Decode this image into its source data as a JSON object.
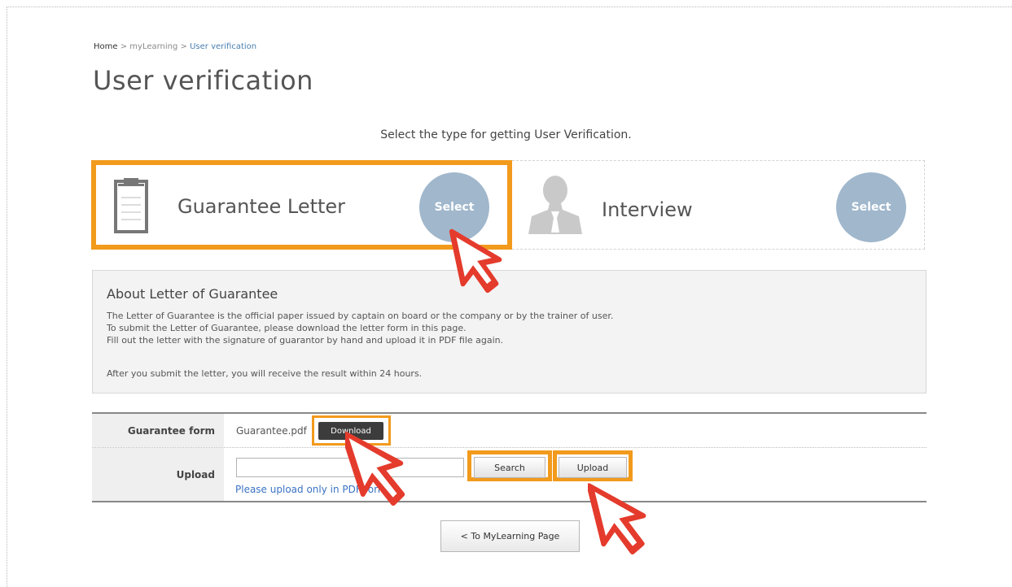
{
  "breadcrumb": {
    "home": "Home",
    "sep1": " > ",
    "mylearning": "myLearning",
    "sep2": " > ",
    "current": "User verification"
  },
  "page": {
    "title": "User verification",
    "instruction": "Select the type for getting User Verification."
  },
  "options": [
    {
      "title": "Guarantee Letter",
      "button": "Select",
      "icon": "clipboard-icon",
      "highlighted": true
    },
    {
      "title": "Interview",
      "button": "Select",
      "icon": "person-icon",
      "highlighted": false
    }
  ],
  "info": {
    "title": "About Letter of Guarantee",
    "lines": [
      "The Letter of Guarantee is the official paper issued by captain on board or the company or by the trainer of user.",
      "To submit the Letter of Guarantee, please download the letter form in this page.",
      "Fill out the letter with the signature of guarantor by hand and upload it in PDF file again."
    ],
    "note": "After you submit the letter, you will receive the result within 24 hours."
  },
  "form": {
    "guarantee_label": "Guarantee form",
    "filename": "Guarantee.pdf",
    "download_button": "Download",
    "upload_label": "Upload",
    "upload_value": "",
    "search_button": "Search",
    "upload_button": "Upload",
    "upload_hint": "Please upload only in PDF format."
  },
  "back_button": "< To MyLearning Page",
  "colors": {
    "highlight": "#f29a1c",
    "select_circle": "#a0b7cc",
    "cursor": "#e43b2c"
  }
}
